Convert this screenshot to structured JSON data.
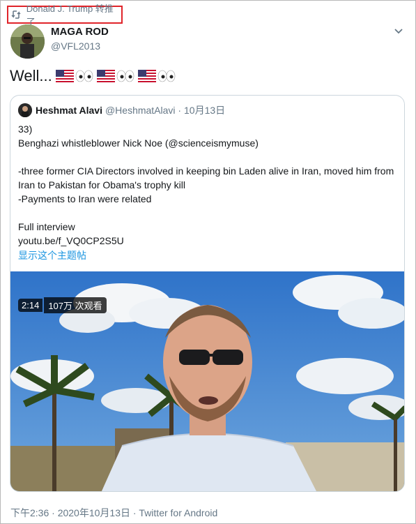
{
  "retweet": {
    "label": "Donald J. Trump 转推了"
  },
  "author": {
    "display_name": "MAGA ROD",
    "handle": "@VFL2013"
  },
  "tweet": {
    "text": "Well..."
  },
  "quoted": {
    "display_name": "Heshmat Alavi",
    "handle": "@HeshmatAlavi",
    "date": "10月13日",
    "lines": [
      "33)",
      "Benghazi whistleblower Nick Noe (@scienceismymuse)",
      "",
      "-three former CIA Directors involved in keeping bin Laden alive in Iran, moved him from Iran to Pakistan for Obama's trophy kill",
      "-Payments to Iran were related",
      "",
      "Full interview"
    ],
    "link": "youtu.be/f_VQ0CP2S5U",
    "show_thread": "显示这个主题帖"
  },
  "video": {
    "duration": "2:14",
    "views": "107万 次观看"
  },
  "footer": {
    "meta": "下午2:36 · 2020年10月13日 · Twitter for Android"
  },
  "icons": {
    "retweet": "retweet-icon",
    "more": "chevron-down-icon"
  },
  "colors": {
    "accent": "#1b95e0",
    "secondary_text": "#657786",
    "highlight_box": "#e0242a"
  }
}
